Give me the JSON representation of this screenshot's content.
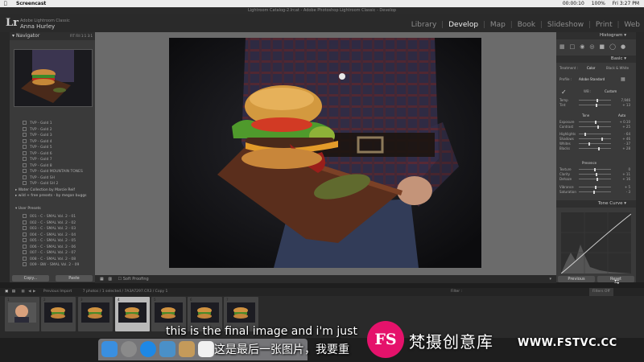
{
  "menubar": {
    "app": "Screencast",
    "recording_time": "00:00:10",
    "battery": "100%",
    "datetime": "Fri 3:27 PM"
  },
  "window": {
    "title": "Lightroom Catalog-2.lrcat - Adobe Photoshop Lightroom Classic - Develop"
  },
  "identity": {
    "logo": "Lr",
    "product": "Adobe Lightroom Classic",
    "user": "Anna Hurley"
  },
  "modules": [
    "Library",
    "Develop",
    "Map",
    "Book",
    "Slideshow",
    "Print",
    "Web"
  ],
  "active_module": "Develop",
  "navigator": {
    "title": "Navigator",
    "zoom_options": [
      "FIT",
      "Fill",
      "1:1",
      "3:1"
    ]
  },
  "presets": {
    "gold_items": [
      "TVP - Gold 1",
      "TVP - Gold 2",
      "TVP - Gold 3",
      "TVP - Gold 4",
      "TVP - Gold 5",
      "TVP - Gold 6",
      "TVP - Gold 7",
      "TVP - Gold 8",
      "TVP - Gold MOUNTAIN TONES",
      "TVP - Gold SH",
      "TVP - Gold SH 2"
    ],
    "groups": [
      "Water Collection by Marcie Reif",
      "wild + free presets - by megan buggs"
    ],
    "user_presets_title": "User Presets",
    "user_items": [
      "001 - C - SMAL Vol. 2 - 01",
      "002 - C - SMAL Vol. 2 - 02",
      "003 - C - SMAL Vol. 2 - 03",
      "004 - C - SMAL Vol. 2 - 04",
      "005 - C - SMAL Vol. 2 - 05",
      "006 - C - SMAL Vol. 2 - 06",
      "007 - C - SMAL Vol. 2 - 07",
      "008 - C - SMAL Vol. 2 - 08",
      "009 - BW - SMAL Vol. 2 - 09"
    ]
  },
  "left_buttons": {
    "copy": "Copy...",
    "paste": "Paste"
  },
  "toolbar": {
    "soft_proofing": "Soft Proofing"
  },
  "right_panel": {
    "histogram": "Histogram",
    "basic": "Basic",
    "treatment_label": "Treatment :",
    "treatment_color": "Color",
    "treatment_bw": "Black & White",
    "profile_label": "Profile :",
    "profile_value": "Adobe Standard",
    "wb_label": "WB :",
    "wb_value": "Custom",
    "tone": "Tone",
    "tone_auto": "Auto",
    "presence": "Presence",
    "tone_curve": "Tone Curve",
    "sliders": [
      {
        "label": "Temp",
        "value": "7,946",
        "pos": 0.58
      },
      {
        "label": "Tint",
        "value": "+ 13",
        "pos": 0.55
      },
      {
        "label": "Exposure",
        "value": "+ 0.10",
        "pos": 0.52
      },
      {
        "label": "Contrast",
        "value": "+ 25",
        "pos": 0.6
      },
      {
        "label": "Highlights",
        "value": "- 64",
        "pos": 0.2
      },
      {
        "label": "Shadows",
        "value": "+ 46",
        "pos": 0.72
      },
      {
        "label": "Whites",
        "value": "- 37",
        "pos": 0.32
      },
      {
        "label": "Blacks",
        "value": "+ 28",
        "pos": 0.63
      },
      {
        "label": "Texture",
        "value": "0",
        "pos": 0.5
      },
      {
        "label": "Clarity",
        "value": "+ 11",
        "pos": 0.55
      },
      {
        "label": "Dehaze",
        "value": "+ 16",
        "pos": 0.58
      },
      {
        "label": "Vibrance",
        "value": "+ 5",
        "pos": 0.52
      },
      {
        "label": "Saturation",
        "value": "- 3",
        "pos": 0.48
      }
    ],
    "previous": "Previous",
    "reset": "Reset"
  },
  "filmstrip_bar": {
    "source": "Previous Import",
    "info": "7 photos / 1 selected / 7A3A7297.CR3 / Copy 1",
    "filter_label": "Filter :",
    "filter_value": "Filters Off"
  },
  "filmstrip": {
    "numbers": [
      "1",
      "2",
      "3",
      "4",
      "5",
      "6",
      "7"
    ]
  },
  "subtitles": {
    "en": "this is the final image and i'm just",
    "zh": "这是最后一张图片，我要重"
  },
  "watermark": {
    "logo": "FS",
    "name": "梵摄创意库",
    "url": "WWW.FSTVC.CC"
  }
}
